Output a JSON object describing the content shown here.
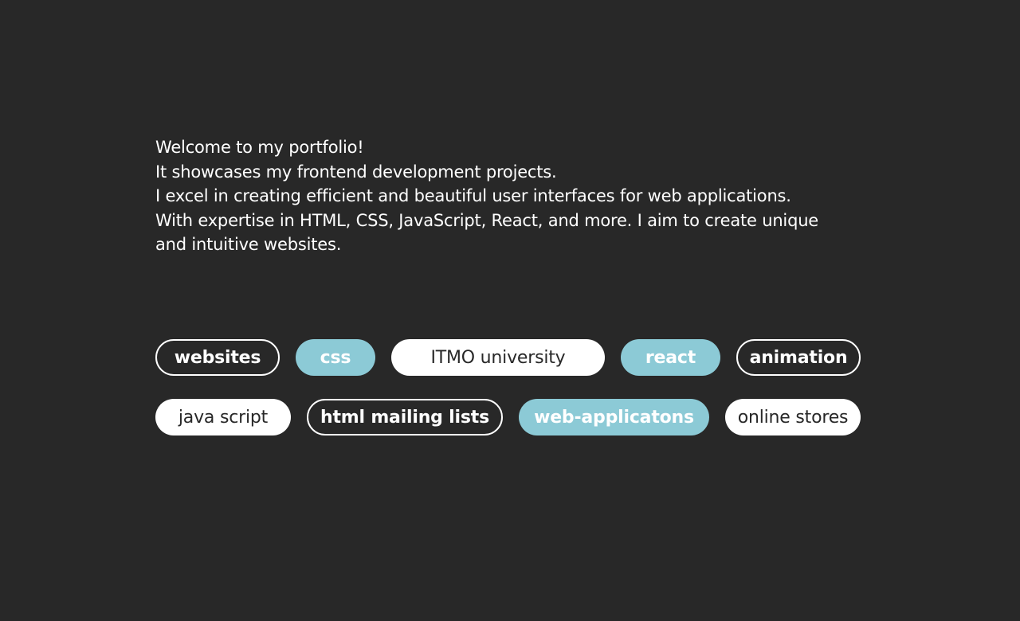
{
  "intro": {
    "lines": [
      "Welcome to my portfolio!",
      "It showcases my frontend development projects.",
      "I excel in creating efficient and beautiful user interfaces for web applications.",
      "With expertise in HTML, CSS, JavaScript, React, and more. I aim to create unique and intuitive websites."
    ]
  },
  "tags": {
    "row1": [
      {
        "label": "websites",
        "style": "outline"
      },
      {
        "label": "css",
        "style": "filled"
      },
      {
        "label": "ITMO university",
        "style": "white"
      },
      {
        "label": "react",
        "style": "filled"
      },
      {
        "label": "animation",
        "style": "outline"
      }
    ],
    "row2": [
      {
        "label": "java script",
        "style": "white"
      },
      {
        "label": "html mailing lists",
        "style": "outline"
      },
      {
        "label": "web-applicatons",
        "style": "filled"
      },
      {
        "label": "online stores",
        "style": "white"
      }
    ]
  },
  "colors": {
    "background": "#282828",
    "accent": "#8ccad6",
    "text": "#ffffff"
  }
}
